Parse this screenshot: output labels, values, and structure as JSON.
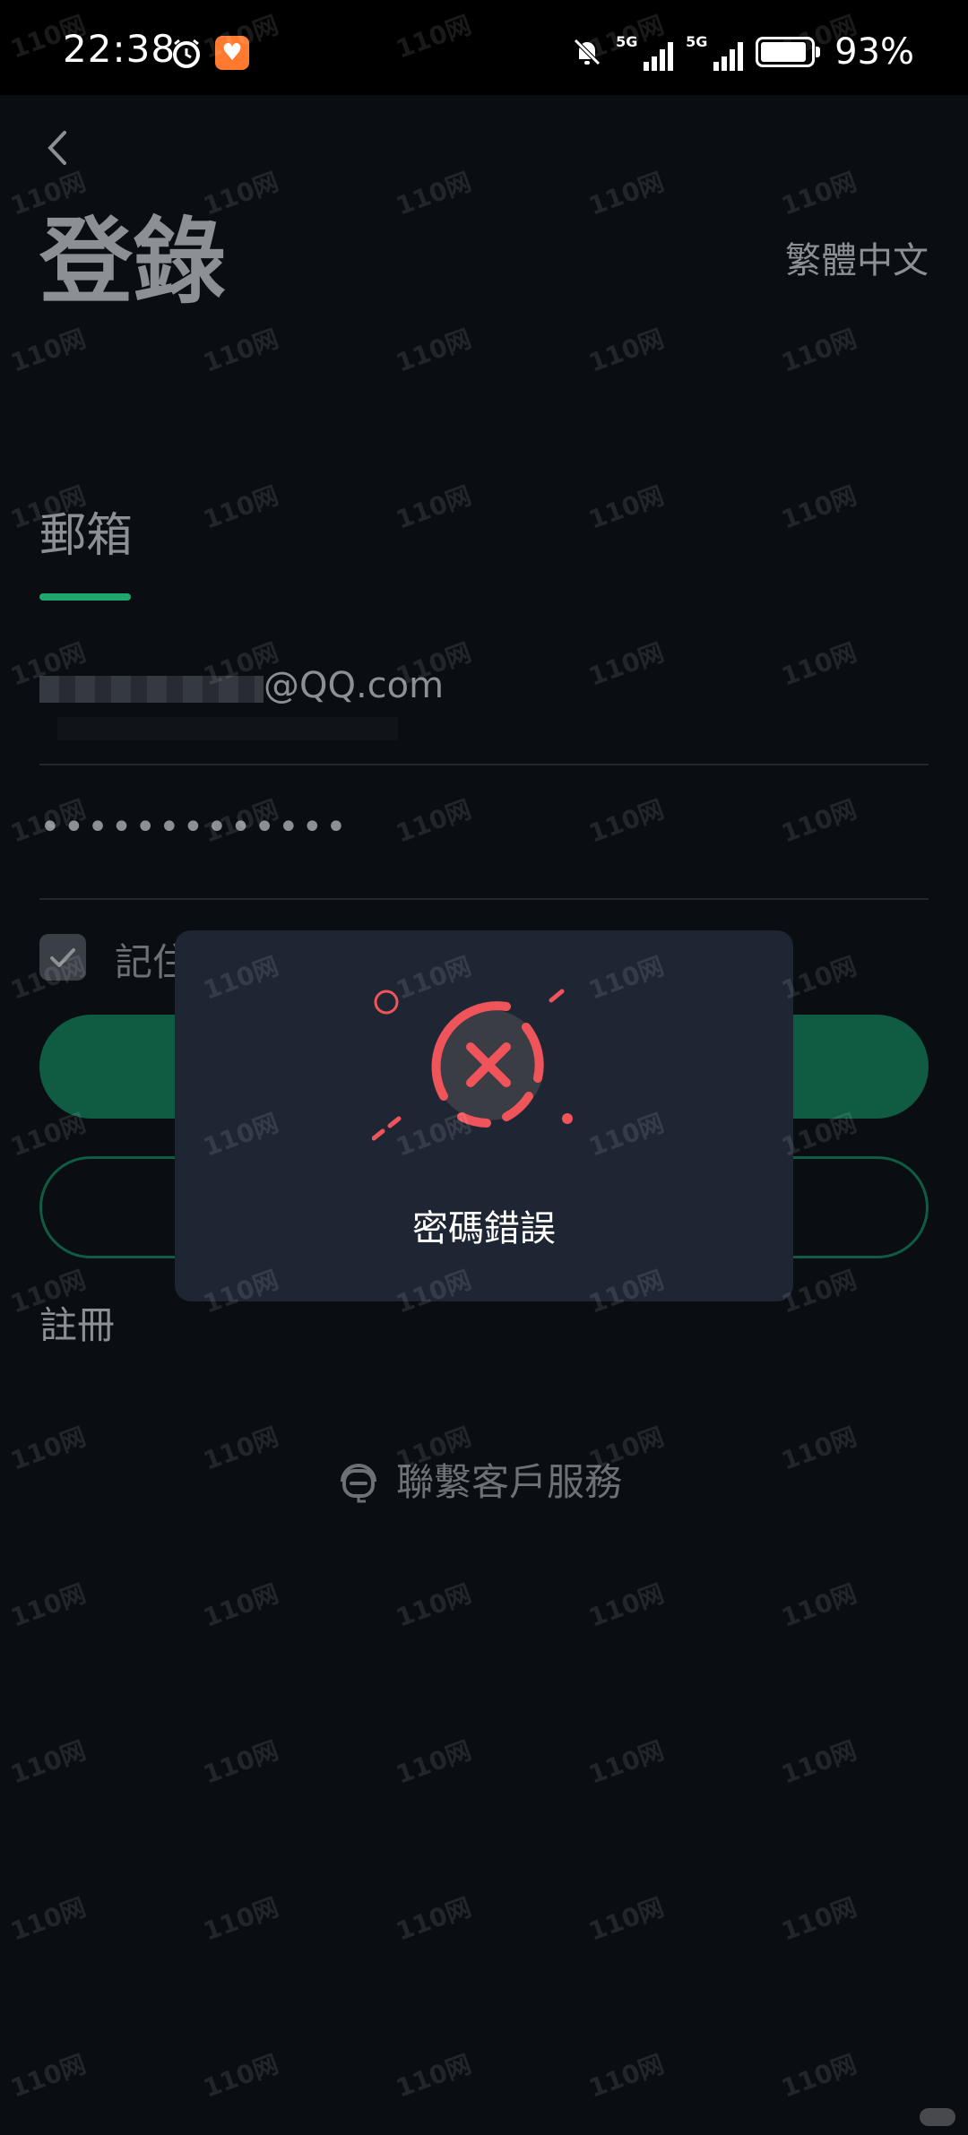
{
  "status_bar": {
    "time": "22:38",
    "network_1": "5G",
    "network_2": "5G",
    "battery_percent": "93%",
    "battery_level": 0.93
  },
  "header": {
    "title": "登錄",
    "language": "繁體中文"
  },
  "tabs": {
    "email_label": "郵箱"
  },
  "form": {
    "email_value": "@QQ.com",
    "password_value": "•••••••••••••",
    "remember_label": "記住",
    "remember_checked": true
  },
  "links": {
    "register": "註冊",
    "customer_service": "聯繫客戶服務"
  },
  "dialog": {
    "message": "密碼錯誤"
  },
  "watermark": {
    "text": "110网"
  },
  "colors": {
    "accent": "#1fa56d",
    "button": "#0f5c43",
    "error": "#f0545b",
    "dialog_bg": "#1f2633",
    "page_bg": "#0a0d12"
  }
}
